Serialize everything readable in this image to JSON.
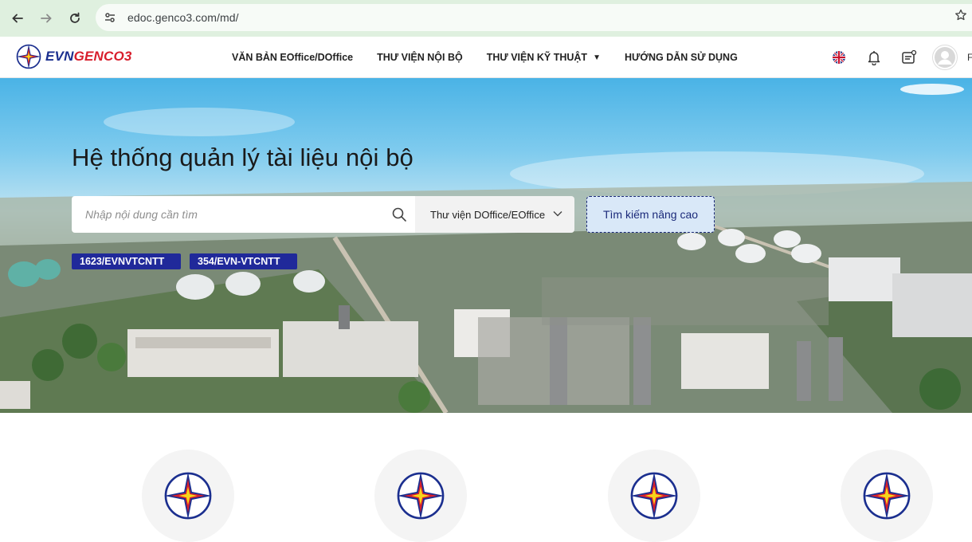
{
  "browser": {
    "url": "edoc.genco3.com/md/"
  },
  "header": {
    "logo": {
      "evn": "EVN",
      "genco": "GENCO3"
    },
    "menu": [
      {
        "label": "VĂN BẢN EOffice/DOffice"
      },
      {
        "label": "THƯ VIỆN NỘI BỘ"
      },
      {
        "label": "THƯ VIỆN KỸ THUẬT",
        "has_dropdown": true
      },
      {
        "label": "HƯỚNG DẪN SỬ DỤNG"
      }
    ],
    "user_initial": "F"
  },
  "hero": {
    "title": "Hệ thống quản lý tài liệu nội bộ",
    "search_placeholder": "Nhập nội dung cần tìm",
    "library_selected": "Thư viện DOffice/EOffice",
    "advanced_search": "Tìm kiếm nâng cao",
    "tags": [
      "1623/EVNVTCNTT",
      "354/EVN-VTCNTT"
    ]
  },
  "colors": {
    "brand_blue": "#20299a",
    "brand_red": "#d81e2c",
    "logo_yellow": "#f6d51a"
  }
}
